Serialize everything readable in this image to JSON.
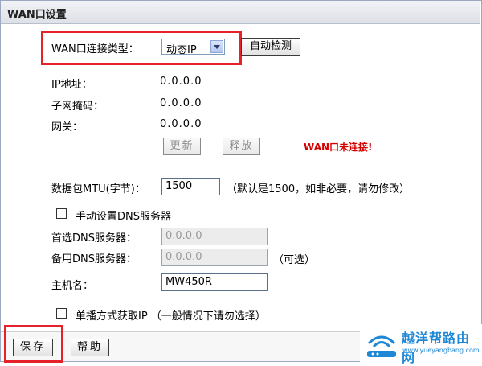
{
  "title": "WAN口设置",
  "wan_type": {
    "label": "WAN口连接类型：",
    "selected": "动态IP",
    "detect_button": "自动检测"
  },
  "info": {
    "ip_label": "IP地址：",
    "ip_value": "0.0.0.0",
    "mask_label": "子网掩码：",
    "mask_value": "0.0.0.0",
    "gateway_label": "网关：",
    "gateway_value": "0.0.0.0",
    "renew_button": "更新",
    "release_button": "释放",
    "status": "WAN口未连接!"
  },
  "mtu": {
    "label": "数据包MTU(字节)：",
    "value": "1500",
    "hint": "（默认是1500，如非必要，请勿修改）"
  },
  "dns": {
    "manual_label": "手动设置DNS服务器",
    "primary_label": "首选DNS服务器：",
    "primary_value": "0.0.0.0",
    "secondary_label": "备用DNS服务器：",
    "secondary_value": "0.0.0.0",
    "optional": "（可选）"
  },
  "host": {
    "label": "主机名：",
    "value": "MW450R"
  },
  "unicast": {
    "label": "单播方式获取IP （一般情况下请勿选择）"
  },
  "footer": {
    "save_button": "保存",
    "help_button": "帮助"
  },
  "watermark": {
    "name": "越洋帮路由网",
    "url": "www.yueyangbang.com",
    "brand_color": "#1e88d6"
  },
  "accent_color": "#e5222a"
}
